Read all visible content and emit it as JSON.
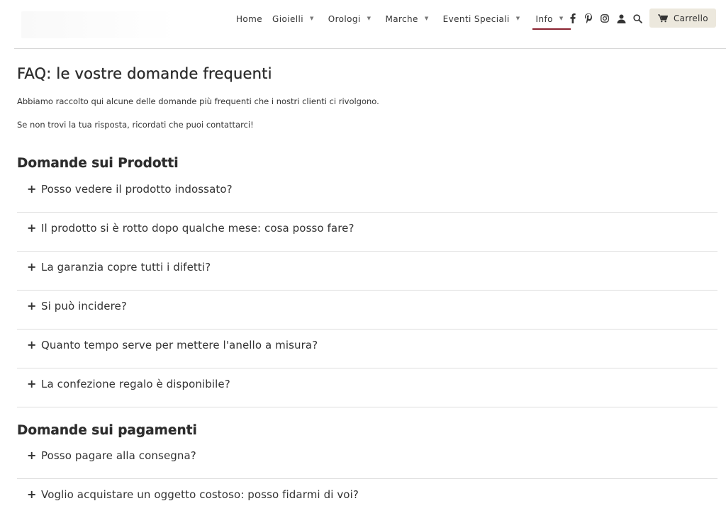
{
  "nav": {
    "items": [
      {
        "label": "Home",
        "has_dropdown": false
      },
      {
        "label": "Gioielli",
        "has_dropdown": true
      },
      {
        "label": "Orologi",
        "has_dropdown": true
      },
      {
        "label": "Marche",
        "has_dropdown": true
      },
      {
        "label": "Eventi Speciali",
        "has_dropdown": true
      },
      {
        "label": "Info",
        "has_dropdown": true,
        "active": true
      }
    ],
    "caret": "▼",
    "icons": [
      "facebook-icon",
      "pinterest-icon",
      "instagram-icon",
      "user-icon",
      "search-icon"
    ],
    "cart_label": "Carrello",
    "active_color": "#8a2230",
    "cart_bg": "#ece8dd"
  },
  "page": {
    "title": "FAQ: le vostre domande frequenti",
    "intro_1": "Abbiamo raccolto qui alcune delle domande più frequenti che i nostri clienti ci rivolgono.",
    "intro_2": "Se non trovi la tua risposta, ricordati che puoi contattarci!"
  },
  "sections": [
    {
      "title": "Domande sui Prodotti",
      "questions": [
        "Posso vedere il prodotto indossato?",
        "Il prodotto si è rotto dopo qualche mese: cosa posso fare?",
        "La garanzia copre tutti i difetti?",
        "Si può incidere?",
        "Quanto tempo serve per mettere l'anello a misura?",
        "La confezione regalo è disponibile?"
      ]
    },
    {
      "title": "Domande sui pagamenti",
      "questions": [
        "Posso pagare alla consegna?",
        "Voglio acquistare un oggetto costoso: posso fidarmi di voi?"
      ]
    }
  ],
  "plus_symbol": "+"
}
